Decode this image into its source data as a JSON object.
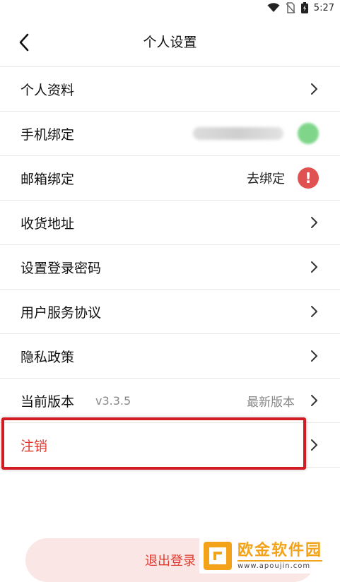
{
  "status_bar": {
    "time": "5:27"
  },
  "header": {
    "title": "个人设置"
  },
  "rows": [
    {
      "label": "个人资料"
    },
    {
      "label": "手机绑定"
    },
    {
      "label": "邮箱绑定",
      "action_text": "去绑定"
    },
    {
      "label": "收货地址"
    },
    {
      "label": "设置登录密码"
    },
    {
      "label": "用户服务协议"
    },
    {
      "label": "隐私政策"
    },
    {
      "label": "当前版本",
      "version": "v3.3.5",
      "status": "最新版本"
    },
    {
      "label": "注销"
    }
  ],
  "logout": {
    "label": "退出登录"
  },
  "watermark": {
    "name": "欧金软件园",
    "url": "www.apoujin.com"
  },
  "colors": {
    "danger": "#e03a2e",
    "highlight": "#d11c24",
    "logout_bg": "#fbe6e6",
    "watermark": "#f2a319"
  }
}
